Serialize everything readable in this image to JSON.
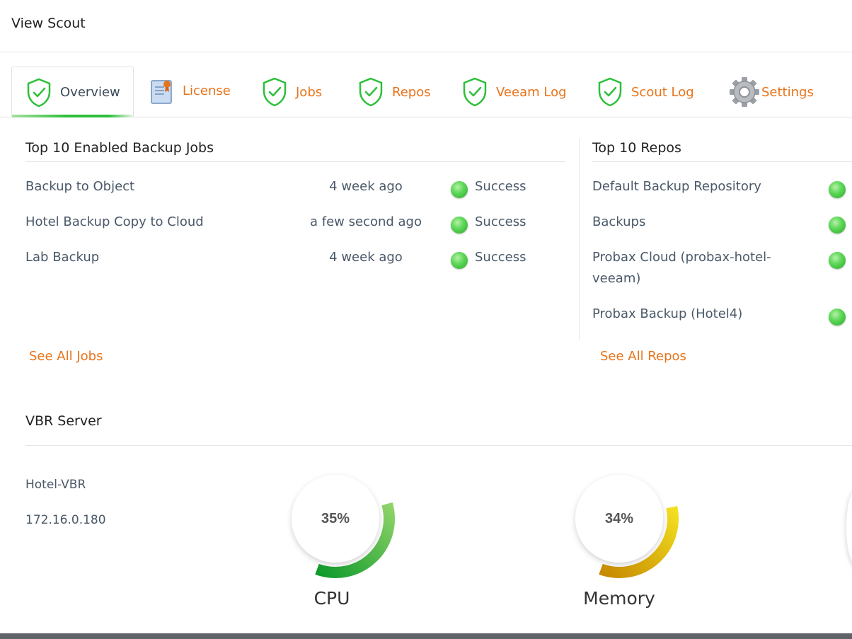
{
  "app": {
    "title": "View Scout"
  },
  "tabs": [
    {
      "label": "Overview",
      "icon": "shield-check-icon",
      "active": true
    },
    {
      "label": "License",
      "icon": "certificate-icon"
    },
    {
      "label": "Jobs",
      "icon": "shield-check-icon"
    },
    {
      "label": "Repos",
      "icon": "shield-check-icon"
    },
    {
      "label": "Veeam Log",
      "icon": "shield-check-icon"
    },
    {
      "label": "Scout Log",
      "icon": "shield-check-icon"
    },
    {
      "label": "Settings",
      "icon": "gear-icon"
    }
  ],
  "jobs": {
    "title": "Top 10 Enabled Backup Jobs",
    "rows": [
      {
        "name": "Backup to Object",
        "time": "4 week ago",
        "status": "Success"
      },
      {
        "name": "Hotel Backup Copy to Cloud",
        "time": "a few second ago",
        "status": "Success"
      },
      {
        "name": "Lab Backup",
        "time": "4 week ago",
        "status": "Success"
      }
    ],
    "see_all": "See All Jobs"
  },
  "repos": {
    "title": "Top 10 Repos",
    "rows": [
      {
        "name": "Default Backup Repository"
      },
      {
        "name": "Backups"
      },
      {
        "name_line1": "Probax Cloud (probax-hotel-",
        "name_line2": "veeam)"
      },
      {
        "name": "Probax Backup (Hotel4)"
      }
    ],
    "see_all": "See All Repos"
  },
  "server": {
    "title": "VBR Server",
    "hostname": "Hotel-VBR",
    "ip": "172.16.0.180",
    "cpu": {
      "label": "CPU",
      "value_text": "35%",
      "value": 35,
      "color_start": "#0f9a2a",
      "color_end": "#8fd46a"
    },
    "memory": {
      "label": "Memory",
      "value_text": "34%",
      "value": 34,
      "color_start": "#c88a00",
      "color_end": "#f3e020"
    }
  },
  "colors": {
    "accent": "#e8731a",
    "success": "#3cc43c"
  }
}
